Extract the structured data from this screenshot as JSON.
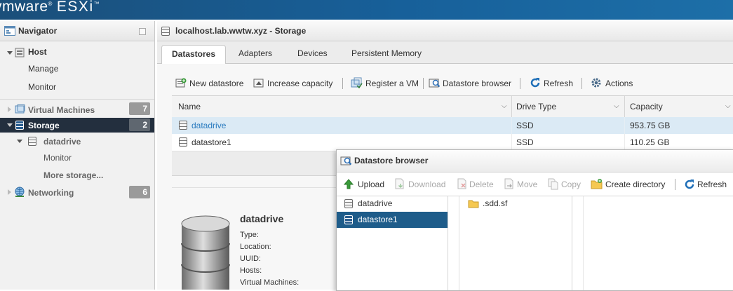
{
  "brand": {
    "vendor": "vmware",
    "product": "ESXi"
  },
  "navigator": {
    "title": "Navigator",
    "host": {
      "label": "Host",
      "children": [
        "Manage",
        "Monitor"
      ]
    },
    "items": [
      {
        "label": "Virtual Machines",
        "count": "7"
      },
      {
        "label": "Storage",
        "count": "2"
      },
      {
        "label": "Networking",
        "count": "6"
      }
    ],
    "storage_children": {
      "datastore": "datadrive",
      "monitor": "Monitor",
      "more": "More storage..."
    }
  },
  "main": {
    "title": "localhost.lab.wwtw.xyz - Storage",
    "tabs": [
      "Datastores",
      "Adapters",
      "Devices",
      "Persistent Memory"
    ],
    "toolbar": [
      "New datastore",
      "Increase capacity",
      "Register a VM",
      "Datastore browser",
      "Refresh",
      "Actions"
    ],
    "columns": [
      "Name",
      "Drive Type",
      "Capacity"
    ],
    "rows": [
      {
        "name": "datadrive",
        "drive_type": "SSD",
        "capacity": "953.75 GB"
      },
      {
        "name": "datastore1",
        "drive_type": "SSD",
        "capacity": "110.25 GB"
      }
    ],
    "details": {
      "name": "datadrive",
      "fields": [
        "Type:",
        "Location:",
        "UUID:",
        "Hosts:",
        "Virtual Machines:"
      ]
    }
  },
  "dialog": {
    "title": "Datastore browser",
    "toolbar": {
      "upload": "Upload",
      "download": "Download",
      "delete": "Delete",
      "move": "Move",
      "copy": "Copy",
      "create_directory": "Create directory",
      "refresh": "Refresh"
    },
    "datastores": [
      "datadrive",
      "datastore1"
    ],
    "folders": [
      ".sdd.sf"
    ]
  },
  "colors": {
    "selection": "#1e5c8a",
    "row_highlight": "#dbeaf5",
    "nav_selected": "#232f3e",
    "link": "#2a7bbf"
  }
}
